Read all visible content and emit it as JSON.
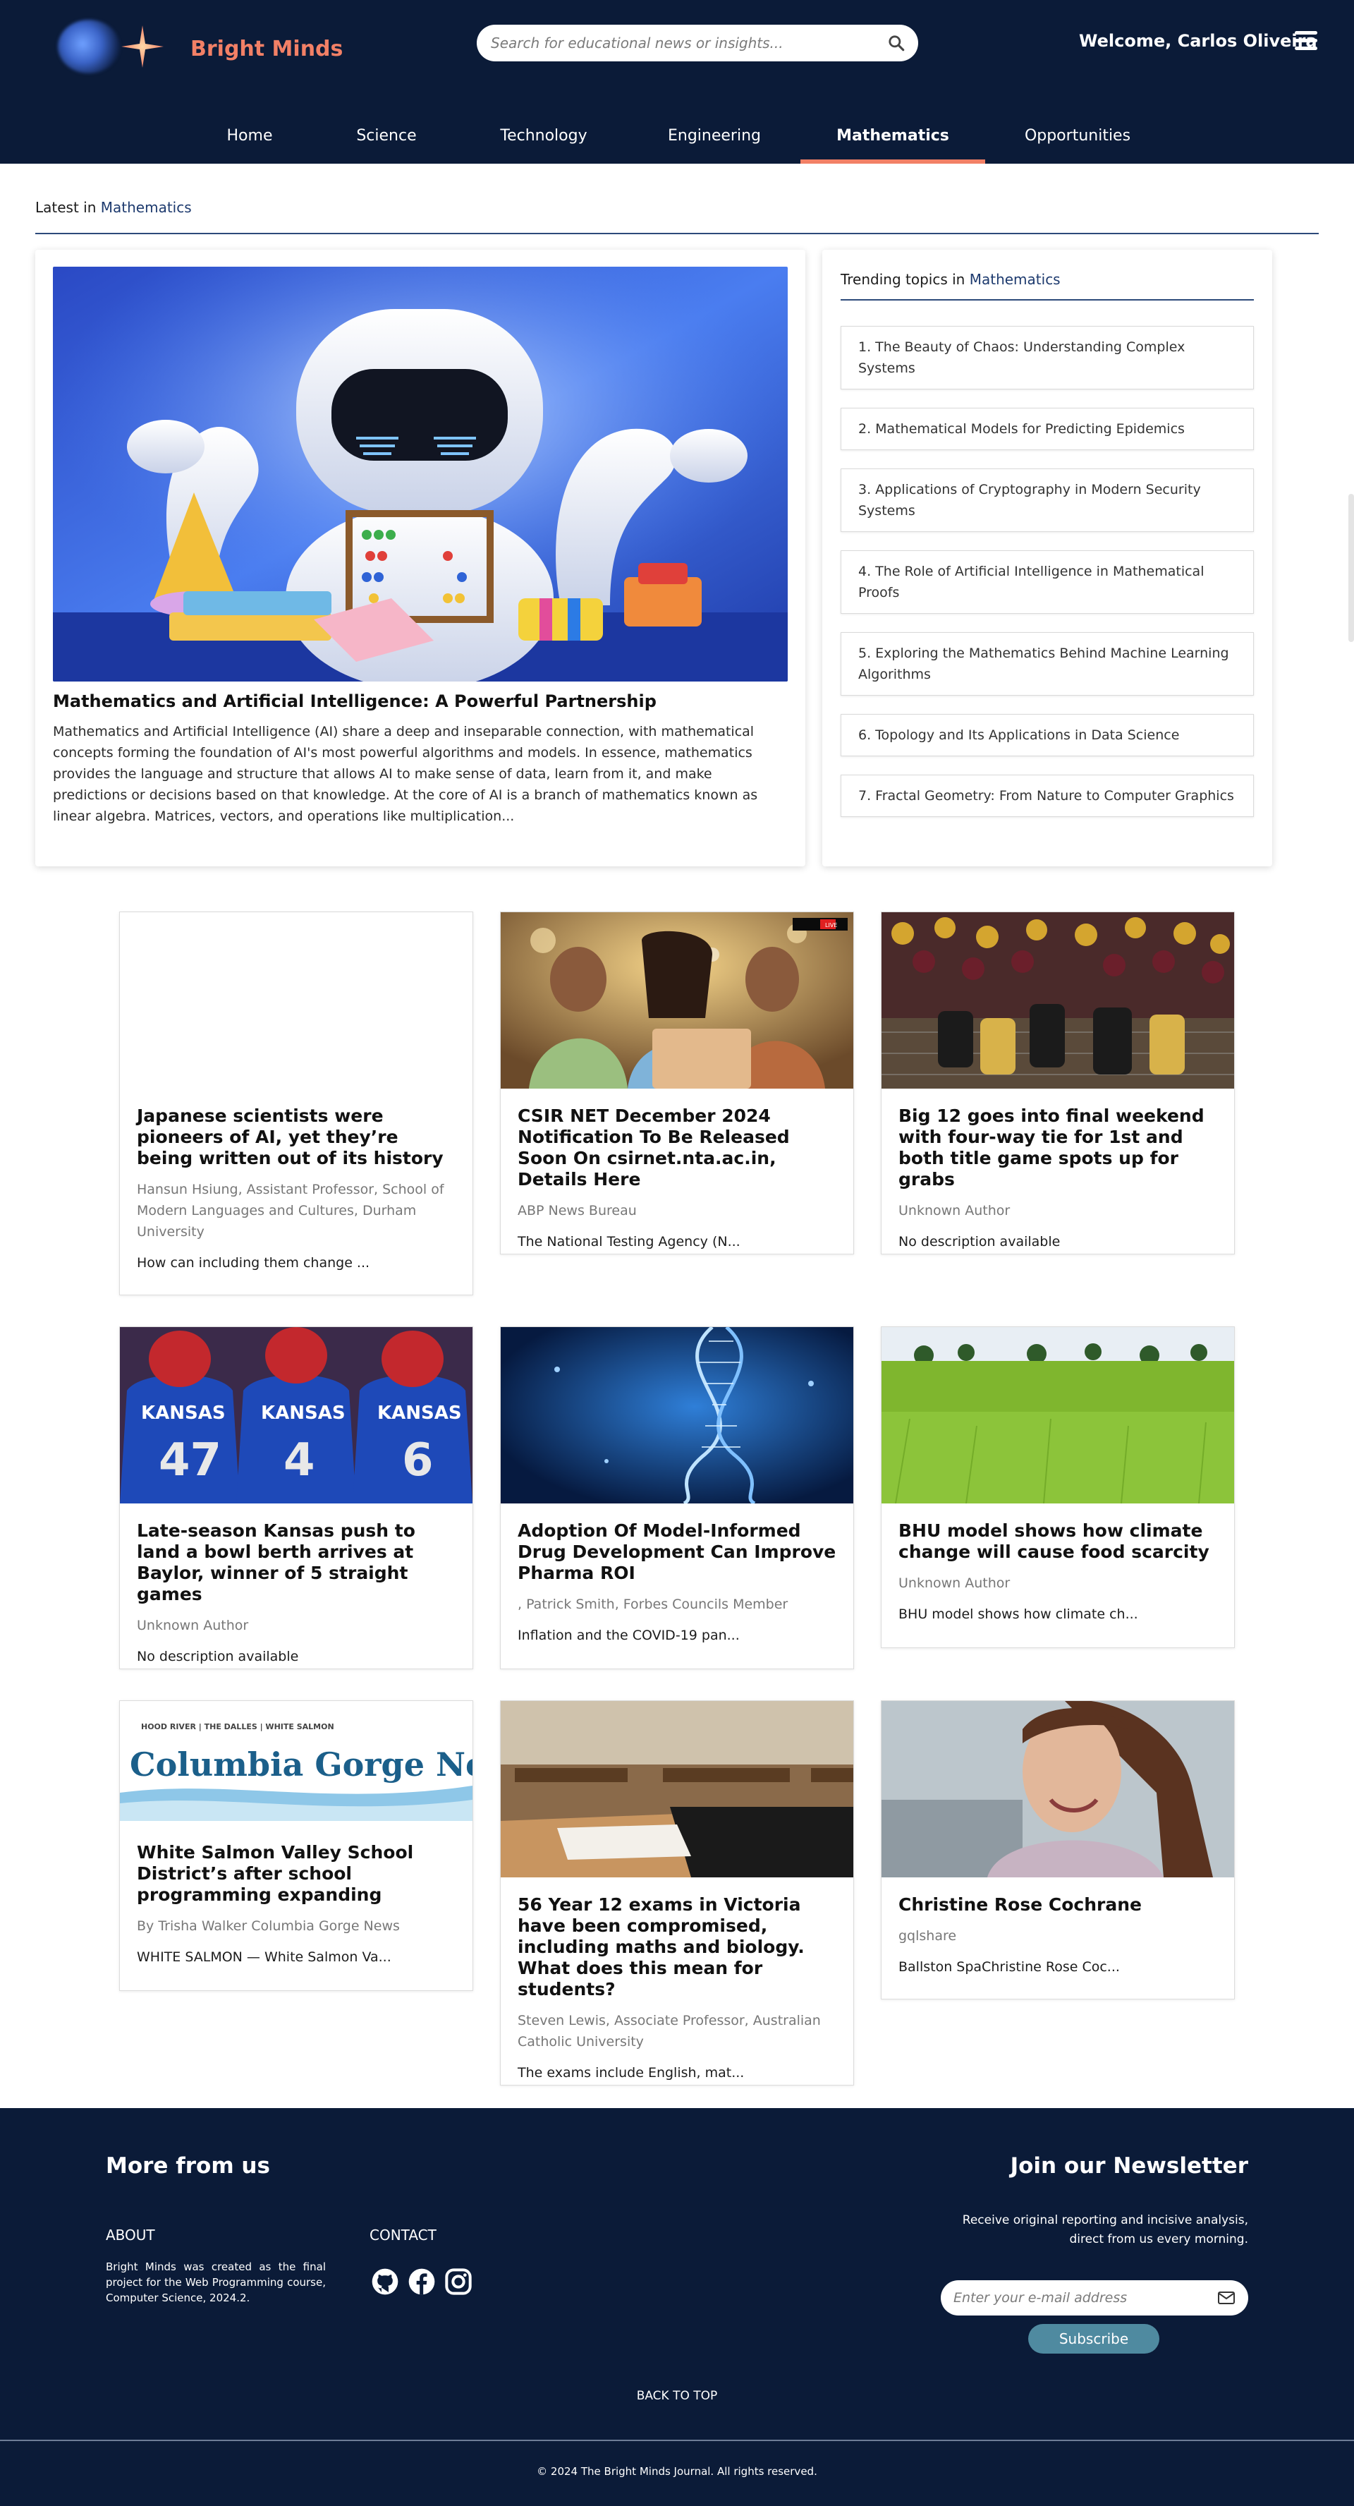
{
  "brand": {
    "name": "Bright Minds"
  },
  "search": {
    "placeholder": "Search for educational news or insights..."
  },
  "user": {
    "welcome": "Welcome, Carlos Oliveira"
  },
  "nav": {
    "items": [
      "Home",
      "Science",
      "Technology",
      "Engineering",
      "Mathematics",
      "Opportunities"
    ],
    "active": "Mathematics"
  },
  "latest": {
    "prefix": "Latest in",
    "category": "Mathematics",
    "feature": {
      "title": "Mathematics and Artificial Intelligence: A Powerful Partnership",
      "description": "Mathematics and Artificial Intelligence (AI) share a deep and inseparable connection, with mathematical concepts forming the foundation of AI's most powerful algorithms and models. In essence, mathematics provides the language and structure that allows AI to make sense of data, learn from it, and make predictions or decisions based on that knowledge. At the core of AI is a branch of mathematics known as linear algebra. Matrices, vectors, and operations like multiplication..."
    }
  },
  "trending": {
    "prefix": "Trending topics in",
    "category": "Mathematics",
    "topics": [
      "1. The Beauty of Chaos: Understanding Complex Systems",
      "2. Mathematical Models for Predicting Epidemics",
      "3. Applications of Cryptography in Modern Security Systems",
      "4. The Role of Artificial Intelligence in Mathematical Proofs",
      "5. Exploring the Mathematics Behind Machine Learning Algorithms",
      "6. Topology and Its Applications in Data Science",
      "7. Fractal Geometry: From Nature to Computer Graphics"
    ]
  },
  "articles": [
    {
      "title": "Japanese scientists were pioneers of AI, yet they’re being written out of its history",
      "author": "Hansun Hsiung, Assistant Professor, School of Modern Languages and Cultures, Durham University",
      "description": "How can including them change ..."
    },
    {
      "title": "CSIR NET December 2024 Notification To Be Released Soon On csirnet.nta.ac.in, Details Here",
      "author": "ABP News Bureau",
      "description": "The National Testing Agency (N...",
      "image_badge": "LIVE"
    },
    {
      "title": "Big 12 goes into final weekend with four-way tie for 1st and both title game spots up for grabs",
      "author": "Unknown Author",
      "description": "No description available"
    },
    {
      "title": "Late-season Kansas push to land a bowl berth arrives at Baylor, winner of 5 straight games",
      "author": "Unknown Author",
      "description": "No description available",
      "image_text": [
        "KANSAS",
        "KANSAS",
        "KANSAS"
      ],
      "image_numbers": [
        "47",
        "4",
        "6"
      ]
    },
    {
      "title": "Adoption Of Model-Informed Drug Development Can Improve Pharma ROI",
      "author": ", Patrick Smith, Forbes Councils Member",
      "description": "Inflation and the COVID-19 pan..."
    },
    {
      "title": "BHU model shows how climate change will cause food scarcity",
      "author": "Unknown Author",
      "description": "BHU model shows how climate ch..."
    },
    {
      "title": "White Salmon Valley School District’s after school programming expanding",
      "author": "By Trisha Walker Columbia Gorge News",
      "description": "WHITE SALMON — White Salmon Va...",
      "image_kicker": "HOOD RIVER | THE DALLES | WHITE SALMON",
      "image_masthead": "Columbia Gorge News"
    },
    {
      "title": "56 Year 12 exams in Victoria have been compromised, including maths and biology. What does this mean for students?",
      "author": "Steven Lewis, Associate Professor, Australian Catholic University",
      "description": "The exams include English, mat..."
    },
    {
      "title": "Christine Rose Cochrane",
      "author": "gqlshare",
      "description": "Ballston SpaChristine Rose Coc..."
    }
  ],
  "footer": {
    "more_heading": "More from us",
    "about_heading": "ABOUT",
    "about_text": "Bright Minds was created as the final project for the Web Programming course, Computer Science, 2024.2.",
    "contact_heading": "CONTACT",
    "social_icons": [
      "github-icon",
      "facebook-icon",
      "instagram-icon"
    ],
    "newsletter_heading": "Join our Newsletter",
    "newsletter_text": "Receive original reporting and incisive analysis, direct from us every morning.",
    "email_placeholder": "Enter your e-mail address",
    "subscribe_label": "Subscribe",
    "back_to_top": "BACK TO TOP",
    "copyright": "© 2024 The Bright Minds Journal. All rights reserved."
  },
  "colors": {
    "navy": "#0b1b38",
    "accent": "#f28066",
    "link": "#1d3a6e",
    "subscribe": "#4f8aa0"
  }
}
